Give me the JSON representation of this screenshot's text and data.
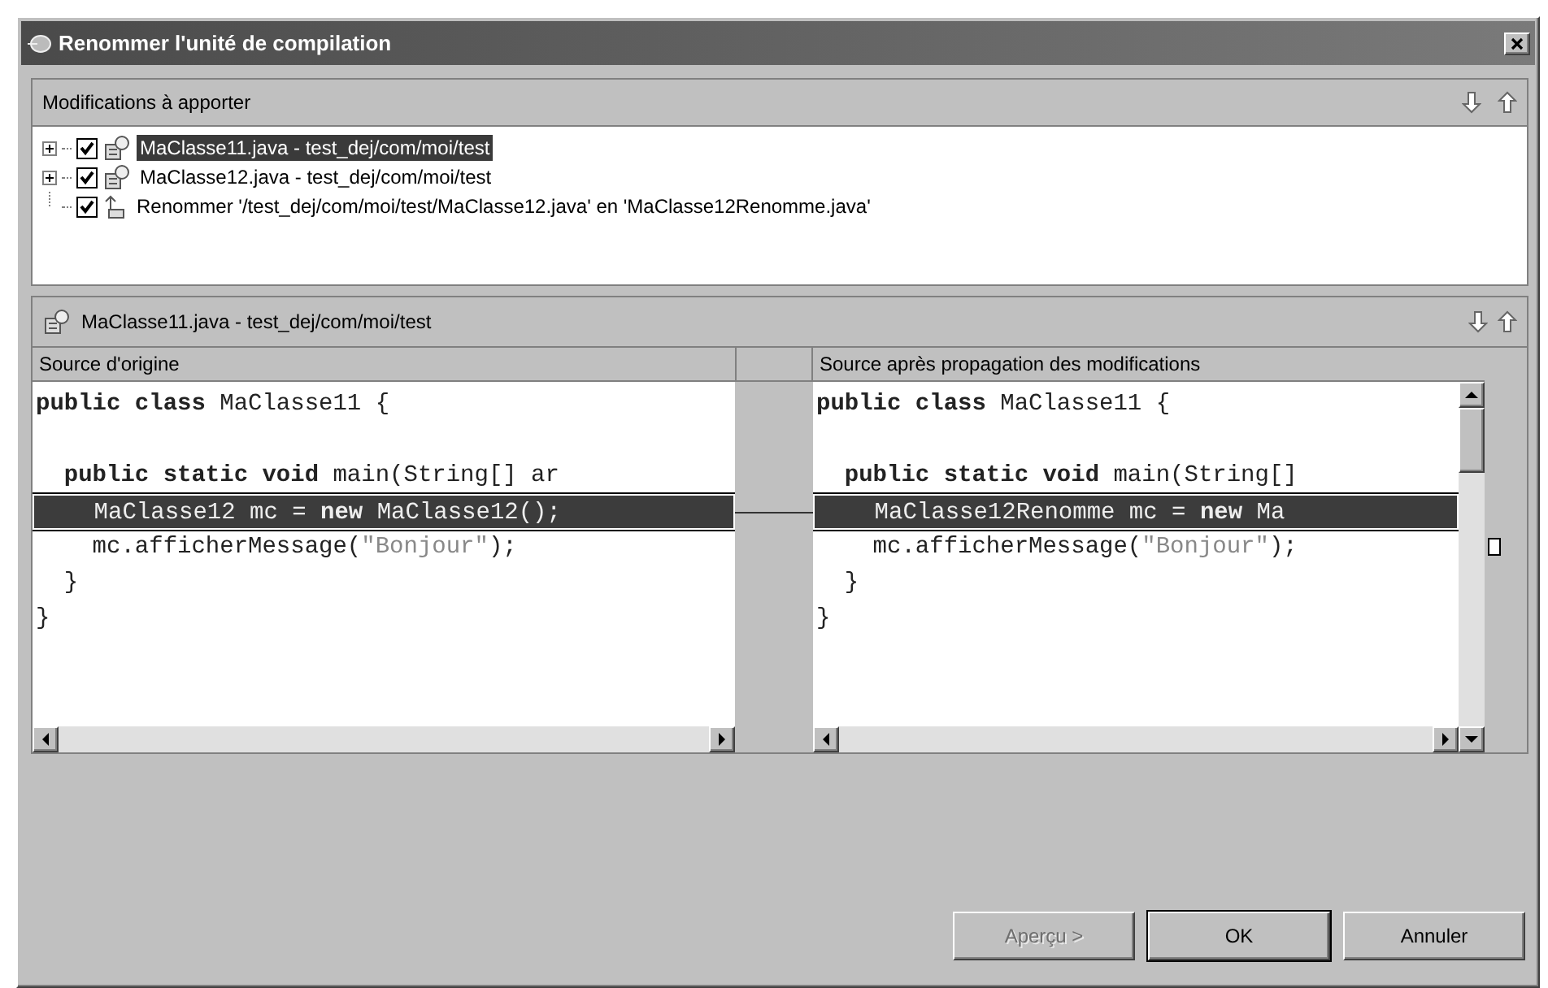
{
  "window": {
    "title": "Renommer l'unité de compilation"
  },
  "changes_panel": {
    "title": "Modifications à apporter",
    "items": [
      {
        "kind": "file",
        "label": "MaClasse11.java - test_dej/com/moi/test",
        "checked": true,
        "expanded": false,
        "selected": true
      },
      {
        "kind": "file",
        "label": "MaClasse12.java - test_dej/com/moi/test",
        "checked": true,
        "expanded": false,
        "selected": false
      },
      {
        "kind": "rename",
        "label": "Renommer '/test_dej/com/moi/test/MaClasse12.java' en 'MaClasse12Renomme.java'",
        "checked": true,
        "selected": false
      }
    ]
  },
  "compare_panel": {
    "title": "MaClasse11.java - test_dej/com/moi/test",
    "left": {
      "heading": "Source d'origine",
      "lines": [
        {
          "selected": false,
          "tokens": [
            {
              "kind": "keyword",
              "text": "public class"
            },
            {
              "kind": "plain",
              "text": " MaClasse11 {"
            }
          ]
        },
        {
          "selected": false
        },
        {
          "selected": false,
          "tokens": [
            {
              "kind": "keyword",
              "text": "  public static void"
            },
            {
              "kind": "plain",
              "text": " main(String[] ar"
            }
          ]
        },
        {
          "selected": true,
          "tokens": [
            {
              "kind": "plain",
              "text": "    MaClasse12 mc = "
            },
            {
              "kind": "keyword",
              "text": "new"
            },
            {
              "kind": "plain",
              "text": " MaClasse12();"
            }
          ]
        },
        {
          "selected": false,
          "tokens": [
            {
              "kind": "plain",
              "text": "    mc.afficherMessage("
            },
            {
              "kind": "string",
              "text": "\"Bonjour\""
            },
            {
              "kind": "plain",
              "text": ");"
            }
          ]
        },
        {
          "selected": false,
          "tokens": [
            {
              "kind": "plain",
              "text": "  }"
            }
          ]
        },
        {
          "selected": false,
          "tokens": [
            {
              "kind": "plain",
              "text": "}"
            }
          ]
        }
      ]
    },
    "right": {
      "heading": "Source après propagation des modifications",
      "lines": [
        {
          "selected": false,
          "tokens": [
            {
              "kind": "keyword",
              "text": "public class"
            },
            {
              "kind": "plain",
              "text": " MaClasse11 {"
            }
          ]
        },
        {
          "selected": false
        },
        {
          "selected": false,
          "tokens": [
            {
              "kind": "keyword",
              "text": "  public static void"
            },
            {
              "kind": "plain",
              "text": " main(String[]"
            }
          ]
        },
        {
          "selected": true,
          "tokens": [
            {
              "kind": "plain",
              "text": "    MaClasse12Renomme mc = "
            },
            {
              "kind": "keyword",
              "text": "new"
            },
            {
              "kind": "plain",
              "text": " Ma"
            }
          ]
        },
        {
          "selected": false,
          "tokens": [
            {
              "kind": "plain",
              "text": "    mc.afficherMessage("
            },
            {
              "kind": "string",
              "text": "\"Bonjour\""
            },
            {
              "kind": "plain",
              "text": ");"
            }
          ]
        },
        {
          "selected": false,
          "tokens": [
            {
              "kind": "plain",
              "text": "  }"
            }
          ]
        },
        {
          "selected": false,
          "tokens": [
            {
              "kind": "plain",
              "text": "}"
            }
          ]
        }
      ]
    }
  },
  "buttons": [
    {
      "label": "Aperçu >",
      "disabled": true,
      "default": false
    },
    {
      "label": "OK",
      "disabled": false,
      "default": true
    },
    {
      "label": "Annuler",
      "disabled": false,
      "default": false
    }
  ]
}
